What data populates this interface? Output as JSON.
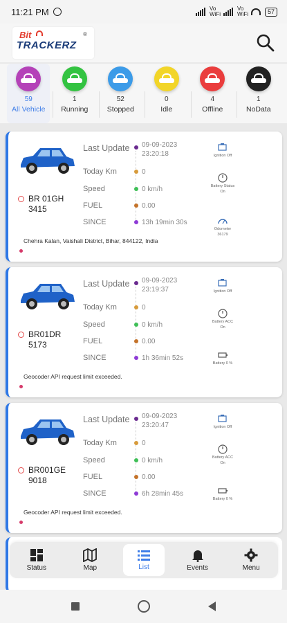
{
  "status_bar": {
    "time": "11:21 PM",
    "net_labels": [
      "Vo WiFi",
      "Vo WiFi"
    ],
    "battery": "57"
  },
  "header": {
    "logo_bit": "Bit",
    "logo_trackerz": "TRACKERZ",
    "logo_reg": "®"
  },
  "filters": [
    {
      "count": "59",
      "label": "All Vehicle",
      "color": "#b442b8",
      "active": true
    },
    {
      "count": "1",
      "label": "Running",
      "color": "#33c341"
    },
    {
      "count": "52",
      "label": "Stopped",
      "color": "#3c9be8"
    },
    {
      "count": "0",
      "label": "Idle",
      "color": "#f2d528"
    },
    {
      "count": "4",
      "label": "Offline",
      "color": "#ea3d3d"
    },
    {
      "count": "1",
      "label": "NoData",
      "color": "#222222"
    }
  ],
  "row_labels": {
    "last_update": "Last Update",
    "today_km": "Today Km",
    "speed": "Speed",
    "fuel": "FUEL",
    "since": "SINCE"
  },
  "vehicles": [
    {
      "plate": "BR 01GH 3415",
      "last_update": "09-09-2023 23:20:18",
      "today_km": "0",
      "speed": "0 km/h",
      "fuel": "0.00",
      "since": "13h 19min 30s",
      "address": "Chehra Kalan, Vaishali District, Bihar, 844122, India",
      "side": [
        "Ignition Off",
        "Battery Status On",
        "Odometer 36179"
      ]
    },
    {
      "plate": "BR01DR 5173",
      "last_update": "09-09-2023 23:19:37",
      "today_km": "0",
      "speed": "0 km/h",
      "fuel": "0.00",
      "since": "1h 36min 52s",
      "address": "Geocoder API request limit exceeded.",
      "side": [
        "Ignition Off",
        "Battery ACC On",
        "Battery 0 %"
      ]
    },
    {
      "plate": "BR001GE 9018",
      "last_update": "09-09-2023 23:20:47",
      "today_km": "0",
      "speed": "0 km/h",
      "fuel": "0.00",
      "since": "6h 28min 45s",
      "address": "Geocoder API request limit exceeded.",
      "side": [
        "Ignition Off",
        "Battery ACC On",
        "Battery 0 %"
      ]
    }
  ],
  "bottom_nav": [
    {
      "label": "Status",
      "icon": "grid-icon"
    },
    {
      "label": "Map",
      "icon": "map-icon"
    },
    {
      "label": "List",
      "icon": "list-icon",
      "active": true
    },
    {
      "label": "Events",
      "icon": "bell-icon"
    },
    {
      "label": "Menu",
      "icon": "gear-icon"
    }
  ],
  "colors": {
    "accent": "#3f7ee8",
    "card_border": "#2f78e6",
    "car_blue": "#1f62c8"
  }
}
